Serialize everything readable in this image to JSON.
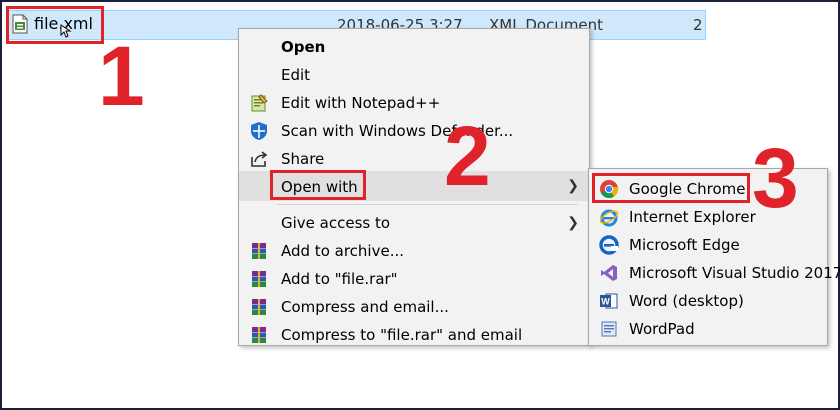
{
  "explorer": {
    "file_name": "file.xml",
    "date_modified": "2018-06-25 3:27",
    "type": "XML Document",
    "size": "2"
  },
  "steps": {
    "one": "1",
    "two": "2",
    "three": "3"
  },
  "context_menu": {
    "items": [
      {
        "label": "Open",
        "icon": "none",
        "bold": true
      },
      {
        "label": "Edit",
        "icon": "none"
      },
      {
        "label": "Edit with Notepad++",
        "icon": "notepad-plus-plus-icon"
      },
      {
        "label": "Scan with Windows Defender...",
        "icon": "windows-defender-shield-icon"
      },
      {
        "label": "Share",
        "icon": "share-icon"
      },
      {
        "label": "Open with",
        "icon": "none",
        "submenu": true
      },
      {
        "label": "Give access to",
        "icon": "none",
        "submenu": true
      },
      {
        "label": "Add to archive...",
        "icon": "winrar-icon"
      },
      {
        "label": "Add to \"file.rar\"",
        "icon": "winrar-icon"
      },
      {
        "label": "Compress and email...",
        "icon": "winrar-icon"
      },
      {
        "label": "Compress to \"file.rar\" and email",
        "icon": "winrar-icon"
      }
    ]
  },
  "open_with_submenu": {
    "items": [
      {
        "label": "Google Chrome",
        "icon": "google-chrome-icon"
      },
      {
        "label": "Internet Explorer",
        "icon": "internet-explorer-icon"
      },
      {
        "label": "Microsoft Edge",
        "icon": "microsoft-edge-icon"
      },
      {
        "label": "Microsoft Visual Studio 2017",
        "icon": "visual-studio-icon"
      },
      {
        "label": "Word (desktop)",
        "icon": "word-icon"
      },
      {
        "label": "WordPad",
        "icon": "wordpad-icon"
      }
    ]
  },
  "colors": {
    "highlight_red": "#e0232a",
    "selection_blue": "#cfe8fb",
    "menu_bg": "#f2f2f2"
  }
}
